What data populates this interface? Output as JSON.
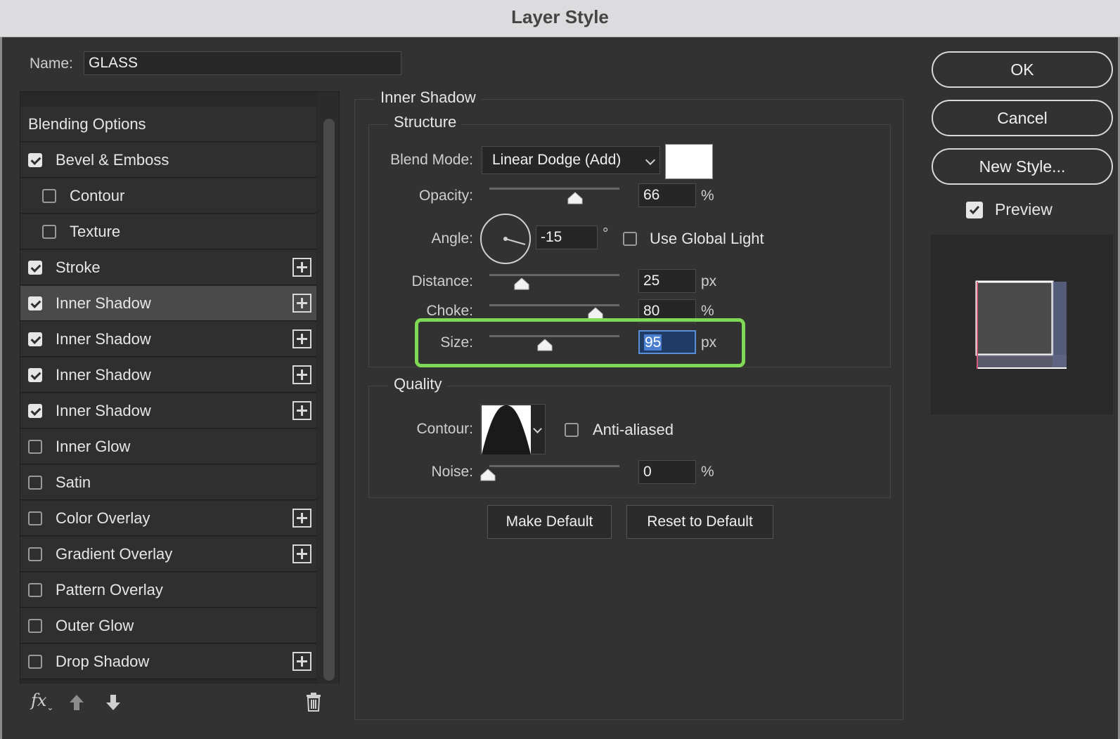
{
  "window": {
    "title": "Layer Style"
  },
  "name_field": {
    "label": "Name:",
    "value": "GLASS"
  },
  "styles_list": {
    "items": [
      {
        "label": "Blending Options",
        "checkbox": false,
        "checked": false,
        "add_button": false,
        "indented": false,
        "selected": false
      },
      {
        "label": "Bevel & Emboss",
        "checkbox": true,
        "checked": true,
        "add_button": false,
        "indented": false,
        "selected": false
      },
      {
        "label": "Contour",
        "checkbox": true,
        "checked": false,
        "add_button": false,
        "indented": true,
        "selected": false
      },
      {
        "label": "Texture",
        "checkbox": true,
        "checked": false,
        "add_button": false,
        "indented": true,
        "selected": false
      },
      {
        "label": "Stroke",
        "checkbox": true,
        "checked": true,
        "add_button": true,
        "indented": false,
        "selected": false
      },
      {
        "label": "Inner Shadow",
        "checkbox": true,
        "checked": true,
        "add_button": true,
        "indented": false,
        "selected": true
      },
      {
        "label": "Inner Shadow",
        "checkbox": true,
        "checked": true,
        "add_button": true,
        "indented": false,
        "selected": false
      },
      {
        "label": "Inner Shadow",
        "checkbox": true,
        "checked": true,
        "add_button": true,
        "indented": false,
        "selected": false
      },
      {
        "label": "Inner Shadow",
        "checkbox": true,
        "checked": true,
        "add_button": true,
        "indented": false,
        "selected": false
      },
      {
        "label": "Inner Glow",
        "checkbox": true,
        "checked": false,
        "add_button": false,
        "indented": false,
        "selected": false
      },
      {
        "label": "Satin",
        "checkbox": true,
        "checked": false,
        "add_button": false,
        "indented": false,
        "selected": false
      },
      {
        "label": "Color Overlay",
        "checkbox": true,
        "checked": false,
        "add_button": true,
        "indented": false,
        "selected": false
      },
      {
        "label": "Gradient Overlay",
        "checkbox": true,
        "checked": false,
        "add_button": true,
        "indented": false,
        "selected": false
      },
      {
        "label": "Pattern Overlay",
        "checkbox": true,
        "checked": false,
        "add_button": false,
        "indented": false,
        "selected": false
      },
      {
        "label": "Outer Glow",
        "checkbox": true,
        "checked": false,
        "add_button": false,
        "indented": false,
        "selected": false
      },
      {
        "label": "Drop Shadow",
        "checkbox": true,
        "checked": false,
        "add_button": true,
        "indented": false,
        "selected": false
      }
    ],
    "footer": {
      "fx_label": "fx",
      "icons": [
        "move-up-icon",
        "move-down-icon",
        "trash-icon"
      ]
    }
  },
  "inner_shadow": {
    "title": "Inner Shadow",
    "structure": {
      "title": "Structure",
      "blend_mode": {
        "label": "Blend Mode:",
        "value": "Linear Dodge (Add)",
        "color": "#ffffff"
      },
      "opacity": {
        "label": "Opacity:",
        "value": "66",
        "unit": "%",
        "level": 0.66
      },
      "angle": {
        "label": "Angle:",
        "value": "-15",
        "unit": "°",
        "use_global_light_label": "Use Global Light",
        "use_global_light": false
      },
      "distance": {
        "label": "Distance:",
        "value": "25",
        "unit": "px"
      },
      "choke": {
        "label": "Choke:",
        "value": "80",
        "unit": "%",
        "level": 0.8
      },
      "size": {
        "label": "Size:",
        "value": "95",
        "unit": "px"
      }
    },
    "quality": {
      "title": "Quality",
      "contour": {
        "label": "Contour:",
        "anti_aliased_label": "Anti-aliased",
        "anti_aliased": false
      },
      "noise": {
        "label": "Noise:",
        "value": "0",
        "unit": "%",
        "level": 0
      }
    },
    "buttons": {
      "make_default": "Make Default",
      "reset_default": "Reset to Default"
    }
  },
  "actions": {
    "ok": "OK",
    "cancel": "Cancel",
    "new_style": "New Style...",
    "preview_label": "Preview",
    "preview_checked": true
  },
  "colors": {
    "highlight": "#7ed957",
    "accent": "#4a7fd0"
  }
}
